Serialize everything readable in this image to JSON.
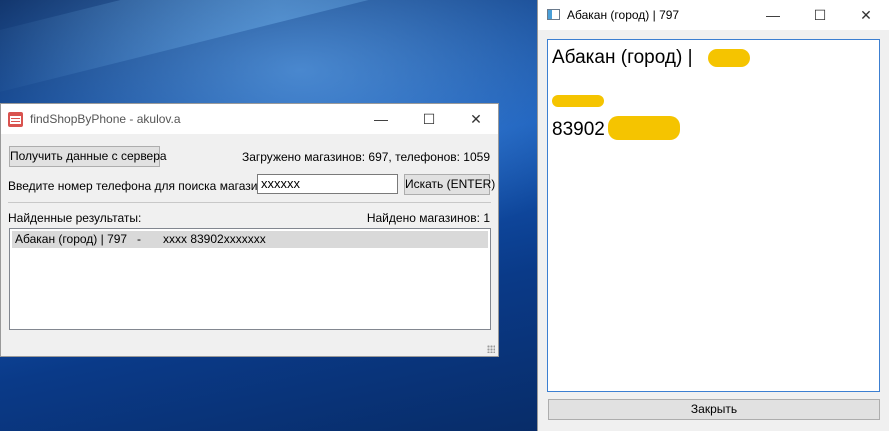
{
  "main_window": {
    "title": "findShopByPhone - akulov.a",
    "controls": {
      "minimize": "—",
      "maximize": "☐",
      "close": "✕"
    },
    "fetch_button": "Получить данные с сервера",
    "loaded_status": "Загружено магазинов: 697, телефонов: 1059",
    "phone_prompt": "Введите номер телефона для поиска магазина:",
    "phone_value": "xxxxxx",
    "search_button": "Искать (ENTER)",
    "results_label": "Найденные результаты:",
    "found_count": "Найдено магазинов: 1",
    "results": [
      {
        "shop": "Абакан (город) | 797",
        "sep": "-",
        "phones": "xxxx 83902xxxxxxx"
      }
    ]
  },
  "detail_window": {
    "title": "Абакан (город) | 797",
    "controls": {
      "minimize": "—",
      "maximize": "☐",
      "close": "✕"
    },
    "heading": "Абакан (город) |",
    "phone_prefix": "83902",
    "close_button": "Закрыть",
    "redaction_color": "#f5c400"
  }
}
